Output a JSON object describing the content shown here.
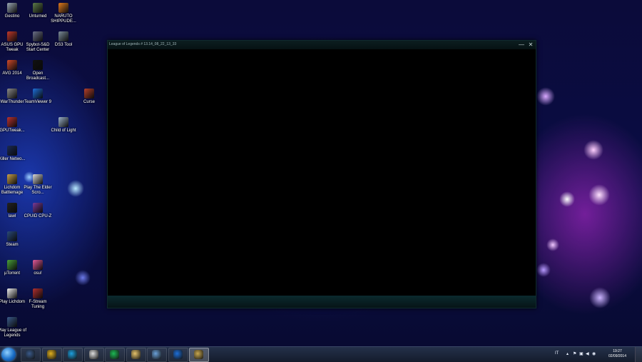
{
  "desktop_icons": [
    {
      "label": "Gestino",
      "color": "#9aa7b4"
    },
    {
      "label": "Unturned",
      "color": "#5d7a4a"
    },
    {
      "label": "NARUTO SHIPPUDE...",
      "color": "#e07a1e"
    },
    {
      "label": "ASUS GPU Tweak",
      "color": "#c0392b"
    },
    {
      "label": "Spybot-S&D Start Center",
      "color": "#6a6f88"
    },
    {
      "label": "DS3 Tool",
      "color": "#7b8b99"
    },
    {
      "label": "AVG 2014",
      "color": "#d04a2a"
    },
    {
      "label": "Open Broadcast...",
      "color": "#111111"
    },
    {
      "label": "WarThunder",
      "color": "#8a8a8a"
    },
    {
      "label": "TeamViewer 9",
      "color": "#1e6fd9"
    },
    {
      "label": "Curse",
      "color": "#b4402b"
    },
    {
      "label": "GPUTweak...",
      "color": "#b83232"
    },
    {
      "label": "Child of Light",
      "color": "#9ab0c8"
    },
    {
      "label": "Killer Netwo...",
      "color": "#1b2a55"
    },
    {
      "label": "Lichdom Battlemage",
      "color": "#c8a04a"
    },
    {
      "label": "Play The Elder Scro...",
      "color": "#d8d8d8"
    },
    {
      "label": "lawl",
      "color": "#222222"
    },
    {
      "label": "CPUID CPU-Z",
      "color": "#7a3b9a"
    },
    {
      "label": "Steam",
      "color": "#2a4a7a"
    },
    {
      "label": "µTorrent",
      "color": "#4aa03a"
    },
    {
      "label": "osu!",
      "color": "#e35a9a"
    },
    {
      "label": "Play Lichdom",
      "color": "#eeeeee"
    },
    {
      "label": "F-Stream Tuning",
      "color": "#b03030"
    },
    {
      "label": "Play League of Legends",
      "color": "#3a5a8a"
    }
  ],
  "window": {
    "title": "League of Legends # 13.14_08_22_13_33",
    "minimize_glyph": "—",
    "close_glyph": "✕"
  },
  "taskbar": {
    "buttons": [
      {
        "name": "league-launcher",
        "color": "#3a5a8a"
      },
      {
        "name": "chrome",
        "color": "#e0b020"
      },
      {
        "name": "skype",
        "color": "#1ea0e0"
      },
      {
        "name": "obs",
        "color": "#dddddd"
      },
      {
        "name": "spotify",
        "color": "#1db954"
      },
      {
        "name": "file-explorer",
        "color": "#e5c36b"
      },
      {
        "name": "remote-desktop",
        "color": "#6aa0d8"
      },
      {
        "name": "teamviewer",
        "color": "#1e6fd9"
      },
      {
        "name": "league-of-legends",
        "color": "#c8a850"
      }
    ],
    "tray": {
      "language": "IT",
      "time": "19:27",
      "date": "02/09/2014"
    }
  }
}
